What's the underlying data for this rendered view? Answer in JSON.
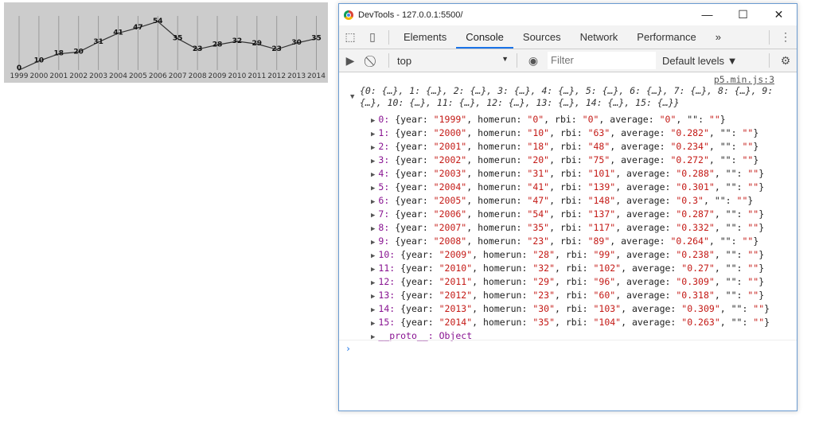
{
  "chart_data": {
    "type": "line",
    "categories": [
      "1999",
      "2000",
      "2001",
      "2002",
      "2003",
      "2004",
      "2005",
      "2006",
      "2007",
      "2008",
      "2009",
      "2010",
      "2011",
      "2012",
      "2013",
      "2014"
    ],
    "values": [
      0,
      10,
      18,
      20,
      31,
      41,
      47,
      54,
      35,
      23,
      28,
      32,
      29,
      23,
      30,
      35
    ],
    "ylim": [
      0,
      54
    ],
    "title": "",
    "xlabel": "",
    "ylabel": "homerun",
    "grid": "vertical"
  },
  "window": {
    "title": "DevTools - 127.0.0.1:5500/",
    "minimize": "—",
    "maximize": "☐",
    "close": "✕"
  },
  "tabs": [
    "Elements",
    "Console",
    "Sources",
    "Network",
    "Performance"
  ],
  "more_tabs": "»",
  "toolbar": {
    "context": "top",
    "filter_placeholder": "Filter",
    "levels": "Default levels ▼"
  },
  "console": {
    "source": "p5.min.js:3",
    "summary": "{0: {…}, 1: {…}, 2: {…}, 3: {…}, 4: {…}, 5: {…}, 6: {…}, 7: {…}, 8: {…}, 9: {…}, 10: {…}, 11: {…}, 12: {…}, 13: {…}, 14: {…}, 15: {…}}",
    "rows": [
      [
        "1999",
        "0",
        "0",
        "0"
      ],
      [
        "2000",
        "10",
        "63",
        "0.282"
      ],
      [
        "2001",
        "18",
        "48",
        "0.234"
      ],
      [
        "2002",
        "20",
        "75",
        "0.272"
      ],
      [
        "2003",
        "31",
        "101",
        "0.288"
      ],
      [
        "2004",
        "41",
        "139",
        "0.301"
      ],
      [
        "2005",
        "47",
        "148",
        "0.3"
      ],
      [
        "2006",
        "54",
        "137",
        "0.287"
      ],
      [
        "2007",
        "35",
        "117",
        "0.332"
      ],
      [
        "2008",
        "23",
        "89",
        "0.264"
      ],
      [
        "2009",
        "28",
        "99",
        "0.238"
      ],
      [
        "2010",
        "32",
        "102",
        "0.27"
      ],
      [
        "2011",
        "29",
        "96",
        "0.309"
      ],
      [
        "2012",
        "23",
        "60",
        "0.318"
      ],
      [
        "2013",
        "30",
        "103",
        "0.309"
      ],
      [
        "2014",
        "35",
        "104",
        "0.263"
      ]
    ],
    "proto": "__proto__: Object",
    "prompt": "›"
  }
}
